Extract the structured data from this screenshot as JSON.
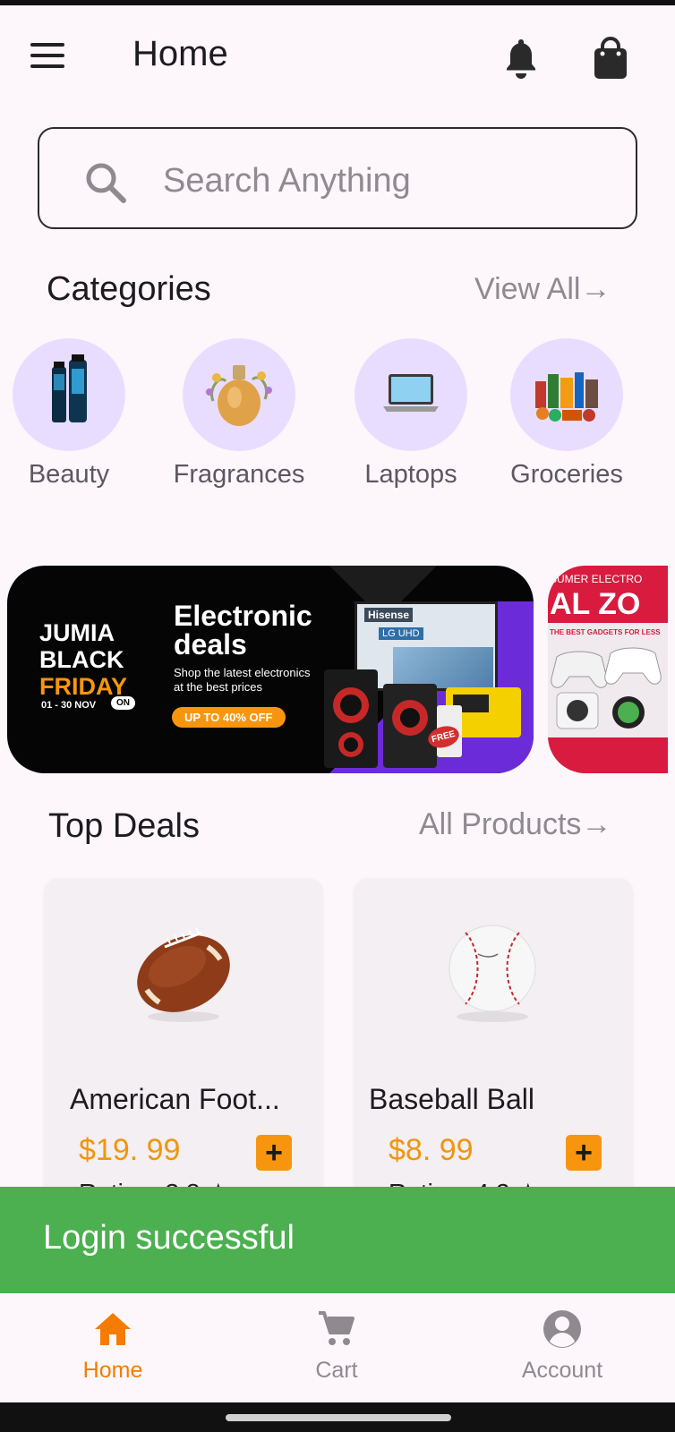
{
  "header": {
    "title": "Home"
  },
  "search": {
    "placeholder": "Search Anything",
    "value": ""
  },
  "categories_section": {
    "title": "Categories",
    "view_all": "View All→",
    "items": [
      {
        "label": "Beauty"
      },
      {
        "label": "Fragrances"
      },
      {
        "label": "Laptops"
      },
      {
        "label": "Groceries"
      }
    ]
  },
  "banners": {
    "main": {
      "brand_line1": "JUMIA",
      "brand_line2": "BLACK",
      "brand_line3": "FRIDAY",
      "dates": "01 - 30 NOV",
      "on_badge": "ON",
      "headline_line1": "Electronic",
      "headline_line2": "deals",
      "subtext_line1": "Shop the latest electronics",
      "subtext_line2": "at the best prices",
      "cta": "UP TO 40% OFF",
      "tv_brand": "Hisense",
      "tv_model": "LG UHD",
      "free_tag": "FREE"
    },
    "side": {
      "top_text": "SUMER ELECTRO",
      "big_text": "AL ZO",
      "sub_text": "THE BEST GADGETS FOR LESS"
    }
  },
  "top_deals": {
    "title": "Top Deals",
    "all_products": "All Products→",
    "products": [
      {
        "name": "American Foot...",
        "price": "$19. 99",
        "rating": "Rating: 3.8 ★"
      },
      {
        "name": "Baseball Ball",
        "price": "$8. 99",
        "rating": "Rating: 4.2 ★"
      }
    ]
  },
  "snackbar": {
    "message": "Login successful"
  },
  "bottom_nav": {
    "items": [
      {
        "label": "Home",
        "icon": "home-icon",
        "active": true
      },
      {
        "label": "Cart",
        "icon": "cart-icon",
        "active": false
      },
      {
        "label": "Account",
        "icon": "account-icon",
        "active": false
      }
    ]
  },
  "colors": {
    "background": "#fdf7fc",
    "accent_orange": "#f7960e",
    "snackbar_green": "#4caf50",
    "category_circle": "#e9ddff"
  }
}
